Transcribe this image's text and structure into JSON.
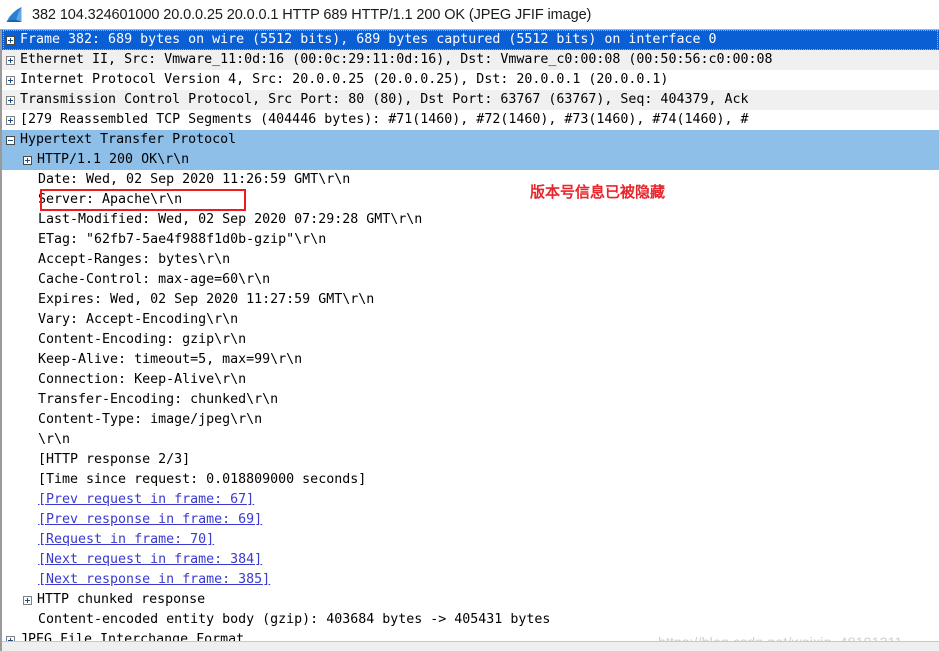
{
  "titlebar": {
    "icon": "wireshark-shark-fin-logo",
    "text": "382 104.324601000 20.0.0.25 20.0.0.1 HTTP 689 HTTP/1.1 200 OK  (JPEG JFIF image)"
  },
  "annotations": {
    "chinese_note": "版本号信息已被隐藏",
    "chinese_note_color": "#e8262c",
    "redbox_color": "#ee1c20",
    "watermark": "https://blog.csdn.net/weixin_48191211"
  },
  "colors": {
    "selected_dark": "#0b5fd4",
    "selected_light": "#8ebfe9",
    "alt_row": "#f0f0f0",
    "link": "#3a3ad0"
  },
  "tree": {
    "rows": [
      {
        "indent": 0,
        "expander": "plus",
        "state": "selected-dark",
        "text": "Frame 382: 689 bytes on wire (5512 bits), 689 bytes captured (5512 bits) on interface 0",
        "name": "tree-row-frame"
      },
      {
        "indent": 0,
        "expander": "plus",
        "state": "alt",
        "text": "Ethernet II, Src: Vmware_11:0d:16 (00:0c:29:11:0d:16), Dst: Vmware_c0:00:08 (00:50:56:c0:00:08",
        "name": "tree-row-ethernet"
      },
      {
        "indent": 0,
        "expander": "plus",
        "state": "normal",
        "text": "Internet Protocol Version 4, Src: 20.0.0.25 (20.0.0.25), Dst: 20.0.0.1 (20.0.0.1)",
        "name": "tree-row-ipv4"
      },
      {
        "indent": 0,
        "expander": "plus",
        "state": "alt",
        "text": "Transmission Control Protocol, Src Port: 80 (80), Dst Port: 63767 (63767), Seq: 404379, Ack",
        "name": "tree-row-tcp"
      },
      {
        "indent": 0,
        "expander": "plus",
        "state": "normal",
        "text": "[279 Reassembled TCP Segments (404446 bytes): #71(1460), #72(1460), #73(1460), #74(1460), #",
        "name": "tree-row-reassembled-segments"
      },
      {
        "indent": 0,
        "expander": "minus",
        "state": "selected-light",
        "text": "Hypertext Transfer Protocol",
        "name": "tree-row-http"
      },
      {
        "indent": 1,
        "expander": "plus",
        "state": "selected-light",
        "text": "HTTP/1.1 200 OK\\r\\n",
        "name": "tree-row-status-line"
      },
      {
        "indent": 1,
        "expander": "none",
        "state": "normal",
        "text": "Date: Wed, 02 Sep 2020 11:26:59 GMT\\r\\n",
        "name": "tree-row-header-date"
      },
      {
        "indent": 1,
        "expander": "none",
        "state": "normal",
        "text": "Server: Apache\\r\\n",
        "name": "tree-row-header-server"
      },
      {
        "indent": 1,
        "expander": "none",
        "state": "normal",
        "text": "Last-Modified: Wed, 02 Sep 2020 07:29:28 GMT\\r\\n",
        "name": "tree-row-header-last-modified"
      },
      {
        "indent": 1,
        "expander": "none",
        "state": "normal",
        "text": "ETag: \"62fb7-5ae4f988f1d0b-gzip\"\\r\\n",
        "name": "tree-row-header-etag"
      },
      {
        "indent": 1,
        "expander": "none",
        "state": "normal",
        "text": "Accept-Ranges: bytes\\r\\n",
        "name": "tree-row-header-accept-ranges"
      },
      {
        "indent": 1,
        "expander": "none",
        "state": "normal",
        "text": "Cache-Control: max-age=60\\r\\n",
        "name": "tree-row-header-cache-control"
      },
      {
        "indent": 1,
        "expander": "none",
        "state": "normal",
        "text": "Expires: Wed, 02 Sep 2020 11:27:59 GMT\\r\\n",
        "name": "tree-row-header-expires"
      },
      {
        "indent": 1,
        "expander": "none",
        "state": "normal",
        "text": "Vary: Accept-Encoding\\r\\n",
        "name": "tree-row-header-vary"
      },
      {
        "indent": 1,
        "expander": "none",
        "state": "normal",
        "text": "Content-Encoding: gzip\\r\\n",
        "name": "tree-row-header-content-encoding"
      },
      {
        "indent": 1,
        "expander": "none",
        "state": "normal",
        "text": "Keep-Alive: timeout=5, max=99\\r\\n",
        "name": "tree-row-header-keep-alive"
      },
      {
        "indent": 1,
        "expander": "none",
        "state": "normal",
        "text": "Connection: Keep-Alive\\r\\n",
        "name": "tree-row-header-connection"
      },
      {
        "indent": 1,
        "expander": "none",
        "state": "normal",
        "text": "Transfer-Encoding: chunked\\r\\n",
        "name": "tree-row-header-transfer-encoding"
      },
      {
        "indent": 1,
        "expander": "none",
        "state": "normal",
        "text": "Content-Type: image/jpeg\\r\\n",
        "name": "tree-row-header-content-type"
      },
      {
        "indent": 1,
        "expander": "none",
        "state": "normal",
        "text": "\\r\\n",
        "name": "tree-row-header-end"
      },
      {
        "indent": 1,
        "expander": "none",
        "state": "normal",
        "text": "[HTTP response 2/3]",
        "name": "tree-row-http-response-index"
      },
      {
        "indent": 1,
        "expander": "none",
        "state": "normal",
        "text": "[Time since request: 0.018809000 seconds]",
        "name": "tree-row-time-since-request"
      },
      {
        "indent": 1,
        "expander": "none",
        "state": "link",
        "text": "[Prev request in frame: 67]",
        "name": "tree-row-prev-request-link"
      },
      {
        "indent": 1,
        "expander": "none",
        "state": "link",
        "text": "[Prev response in frame: 69]",
        "name": "tree-row-prev-response-link"
      },
      {
        "indent": 1,
        "expander": "none",
        "state": "link",
        "text": "[Request in frame: 70]",
        "name": "tree-row-request-link"
      },
      {
        "indent": 1,
        "expander": "none",
        "state": "link",
        "text": "[Next request in frame: 384]",
        "name": "tree-row-next-request-link"
      },
      {
        "indent": 1,
        "expander": "none",
        "state": "link",
        "text": "[Next response in frame: 385]",
        "name": "tree-row-next-response-link"
      },
      {
        "indent": 1,
        "expander": "plus",
        "state": "normal",
        "text": "HTTP chunked response",
        "name": "tree-row-chunked-response"
      },
      {
        "indent": 1,
        "expander": "none",
        "state": "normal",
        "text": "Content-encoded entity body (gzip): 403684 bytes -> 405431 bytes",
        "name": "tree-row-content-encoded-entity-body"
      },
      {
        "indent": 0,
        "expander": "plus",
        "state": "normal",
        "text": "JPEG File Interchange Format",
        "name": "tree-row-jpeg"
      }
    ]
  }
}
